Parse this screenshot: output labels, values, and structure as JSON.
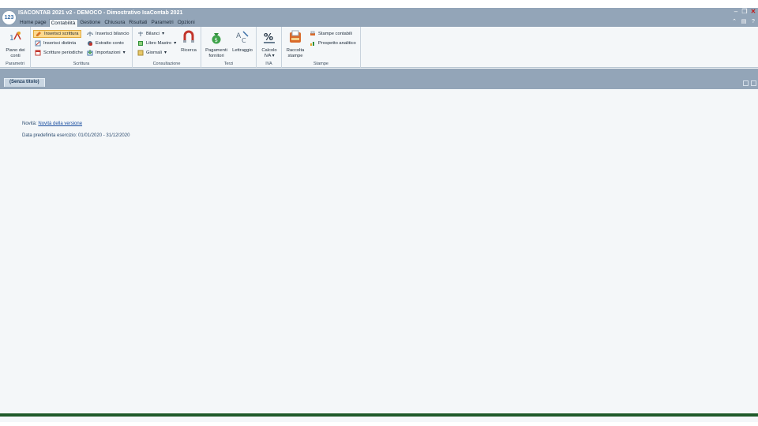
{
  "window": {
    "title": "ISACONTAB 2021 v2 - DEMOCO - Dimostrativo IsaContab 2021",
    "logo_text": "123"
  },
  "menu": {
    "tabs": [
      {
        "label": "Home page"
      },
      {
        "label": "Contabilità",
        "active": true
      },
      {
        "label": "Gestione"
      },
      {
        "label": "Chiusura"
      },
      {
        "label": "Risultati"
      },
      {
        "label": "Parametri"
      },
      {
        "label": "Opzioni"
      }
    ]
  },
  "ribbon": {
    "groups": {
      "parametri": {
        "label": "Parametri",
        "piano_conti": "Piano dei conti"
      },
      "scrittura": {
        "label": "Scrittura",
        "inserisci_scrittura": "Inserisci scrittura",
        "inserisci_distinta": "Inserisci distinta",
        "scritture_periodiche": "Scritture periodiche",
        "inserisci_bilancio": "Inserisci bilancio",
        "estratto_conto": "Estratto conto",
        "importazioni": "Importazioni"
      },
      "consultazione": {
        "label": "Consultazione",
        "bilanci": "Bilanci",
        "libro_mastro": "Libro Mastro",
        "giornali": "Giornali",
        "ricerca": "Ricerca"
      },
      "terzi": {
        "label": "Terzi",
        "pagamenti_fornitori": "Pagamenti fornitori",
        "lettraggio": "Lettraggio"
      },
      "iva": {
        "label": "IVA",
        "calcolo_iva": "Calcolo IVA"
      },
      "stampe": {
        "label": "Stampe",
        "raccolta_stampe": "Raccolta stampe",
        "stampe_contabili": "Stampe contabili",
        "prospetto_analitico": "Prospetto analitico"
      }
    }
  },
  "document": {
    "tab_label": "(Senza titolo)",
    "novita_label": "Novità:",
    "novita_link": "Novità della versione",
    "data_predefinita": "Data predefinita esercizio: 01/01/2020 - 31/12/2020"
  },
  "colors": {
    "chrome": "#93a5b8",
    "ribbon_bg": "#f4f7f9",
    "highlight": "#fcd98e",
    "link": "#1b4fa0",
    "status_bar": "#1f5a2a"
  }
}
